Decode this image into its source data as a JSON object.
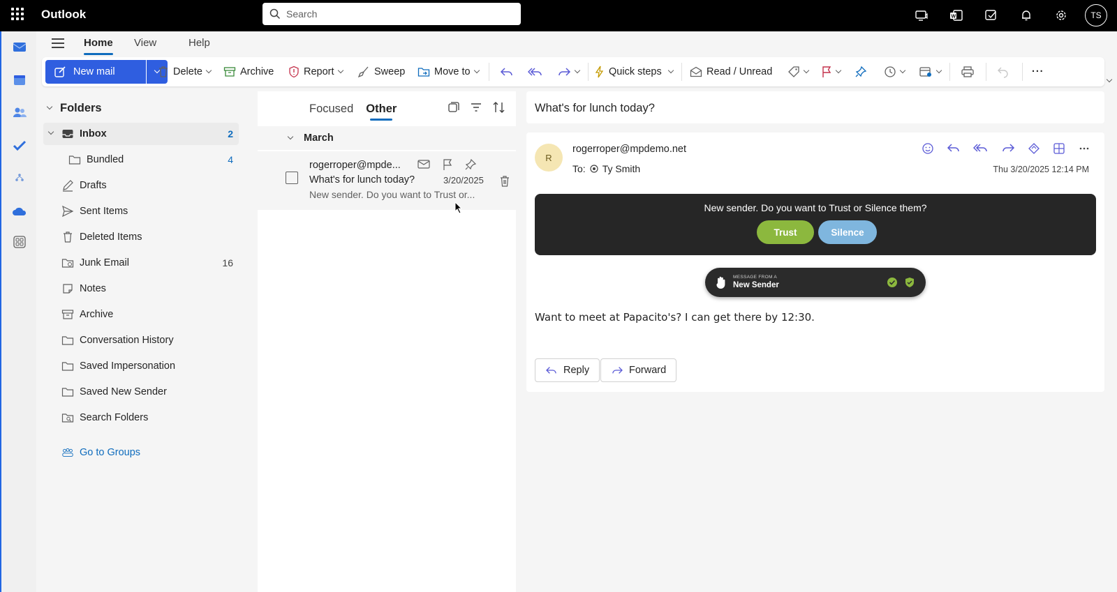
{
  "app": {
    "name": "Outlook",
    "user_initials": "TS"
  },
  "search": {
    "placeholder": "Search"
  },
  "tabs": [
    {
      "label": "Home",
      "active": true
    },
    {
      "label": "View",
      "active": false
    },
    {
      "label": "Help",
      "active": false
    }
  ],
  "ribbon": {
    "new_mail": "New mail",
    "delete": "Delete",
    "archive": "Archive",
    "report": "Report",
    "sweep": "Sweep",
    "move_to": "Move to",
    "quick_steps": "Quick steps",
    "read_unread": "Read / Unread",
    "more": "···"
  },
  "folders": {
    "heading": "Folders",
    "items": [
      {
        "label": "Inbox",
        "count": "2",
        "selected": true,
        "icon": "inbox-icon"
      },
      {
        "label": "Bundled",
        "count": "4",
        "icon": "folder-icon"
      },
      {
        "label": "Drafts",
        "count": "",
        "icon": "pencil-icon"
      },
      {
        "label": "Sent Items",
        "count": "",
        "icon": "send-icon"
      },
      {
        "label": "Deleted Items",
        "count": "",
        "icon": "trash-icon"
      },
      {
        "label": "Junk Email",
        "count": "16",
        "icon": "junk-icon"
      },
      {
        "label": "Notes",
        "count": "",
        "icon": "note-icon"
      },
      {
        "label": "Archive",
        "count": "",
        "icon": "archive-icon"
      },
      {
        "label": "Conversation History",
        "count": "",
        "icon": "folder-icon"
      },
      {
        "label": "Saved Impersonation",
        "count": "",
        "icon": "folder-icon"
      },
      {
        "label": "Saved New Sender",
        "count": "",
        "icon": "folder-icon"
      },
      {
        "label": "Search Folders",
        "count": "",
        "icon": "search-folder-icon"
      }
    ],
    "go_to_groups": "Go to Groups"
  },
  "message_list": {
    "tab_focused": "Focused",
    "tab_other": "Other",
    "group_label": "March",
    "messages": [
      {
        "from": "rogerroper@mpde...",
        "subject": "What's for lunch today?",
        "date": "3/20/2025",
        "preview": "New sender. Do you want to Trust or..."
      }
    ]
  },
  "reading_pane": {
    "subject": "What's for lunch today?",
    "sender_initial": "R",
    "from": "rogerroper@mpdemo.net",
    "to_label": "To:",
    "to_name": "Ty Smith",
    "date": "Thu 3/20/2025 12:14 PM",
    "banner_text": "New sender. Do you want to Trust or Silence them?",
    "trust_label": "Trust",
    "silence_label": "Silence",
    "pill_small": "MESSAGE FROM A",
    "pill_big": "New Sender",
    "body": "Want to meet at Papacito's? I can get there by 12:30.",
    "reply_label": "Reply",
    "forward_label": "Forward"
  },
  "colors": {
    "accent": "#0f6cbd",
    "new_mail_button": "#2f5ee0",
    "trust_button": "#8cb83e",
    "silence_button": "#7fb6de",
    "banner_bg": "#262626",
    "avatar_bg": "#f5e6b3"
  }
}
